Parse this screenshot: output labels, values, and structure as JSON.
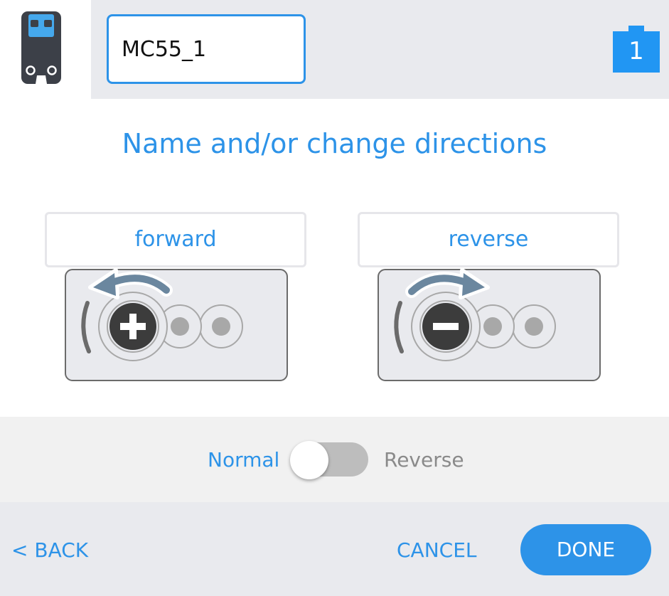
{
  "header": {
    "device_icon": "motor-controller-icon",
    "name_value": "MC55_1",
    "port_icon": "port-badge-icon",
    "port_number": "1"
  },
  "main": {
    "heading": "Name and/or change directions",
    "directions": [
      {
        "label": "forward",
        "icon": "rotate-counterclockwise-icon",
        "terminal_icon": "plus-icon"
      },
      {
        "label": "reverse",
        "icon": "rotate-clockwise-icon",
        "terminal_icon": "minus-icon"
      }
    ]
  },
  "toggle": {
    "left_label": "Normal",
    "right_label": "Reverse",
    "state": "Normal"
  },
  "footer": {
    "back_label": "< BACK",
    "cancel_label": "CANCEL",
    "done_label": "DONE"
  },
  "colors": {
    "accent": "#2d93e8",
    "panel_gray": "#e9eaee",
    "icon_dark": "#3c4048"
  }
}
